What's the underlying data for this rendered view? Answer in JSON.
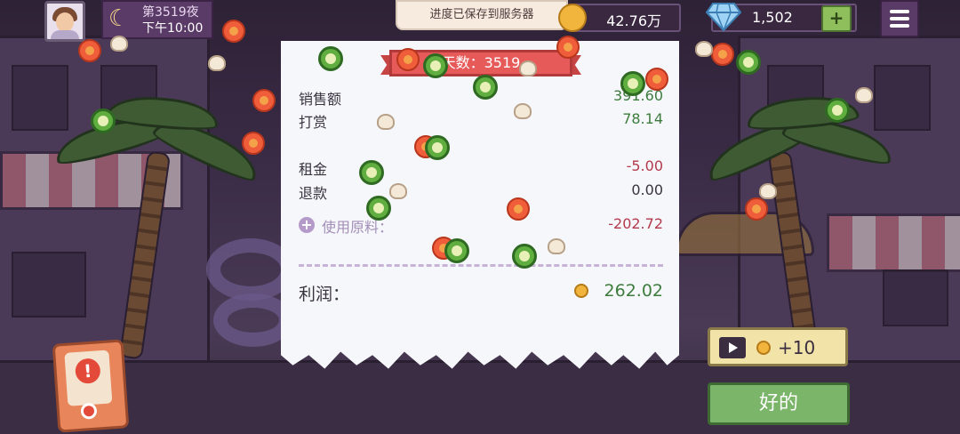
{
  "hud": {
    "day": "第3519夜",
    "time": "下午10:00",
    "toast": "进度已保存到服务器",
    "coins": "42.76万",
    "gems": "1,502",
    "gem_plus": "+"
  },
  "receipt": {
    "banner": "天数：3519",
    "rows": [
      {
        "label": "销售额",
        "value": "391.60"
      },
      {
        "label": "打赏",
        "value": "78.14"
      },
      {
        "label": "租金",
        "value": "-5.00"
      },
      {
        "label": "退款",
        "value": "0.00"
      },
      {
        "label": "使用原料：",
        "value": "-202.72"
      }
    ],
    "profit_label": "利润：",
    "profit_value": "262.02"
  },
  "buttons": {
    "ad_reward": "+10",
    "ok": "好的",
    "alert": "!"
  },
  "colors": {
    "positive": "#3e7c3e",
    "negative": "#b33a4a",
    "ribbon": "#e75a5a",
    "ok_button": "#7bb56a",
    "ad_button": "#f2e3a8"
  }
}
